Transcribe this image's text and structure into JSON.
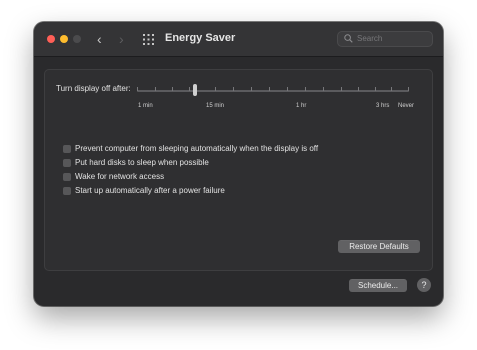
{
  "window": {
    "title": "Energy Saver",
    "search_placeholder": "Search",
    "nav_back": "‹",
    "nav_forward": "›",
    "help": "?"
  },
  "slider": {
    "label": "Turn display off after:",
    "value": "15 min",
    "tick_labels": [
      "1 min",
      "15 min",
      "1 hr",
      "3 hrs",
      "Never"
    ]
  },
  "options": [
    {
      "label": "Prevent computer from sleeping automatically when the display is off",
      "checked": false
    },
    {
      "label": "Put hard disks to sleep when possible",
      "checked": false
    },
    {
      "label": "Wake for network access",
      "checked": false
    },
    {
      "label": "Start up automatically after a power failure",
      "checked": false
    }
  ],
  "buttons": {
    "restore_defaults": "Restore Defaults",
    "schedule": "Schedule..."
  },
  "colors": {
    "window_bg": "#2a2a2c",
    "close": "#ff5f57",
    "minimize": "#febc2e",
    "zoom_disabled": "#4b4b4d"
  }
}
